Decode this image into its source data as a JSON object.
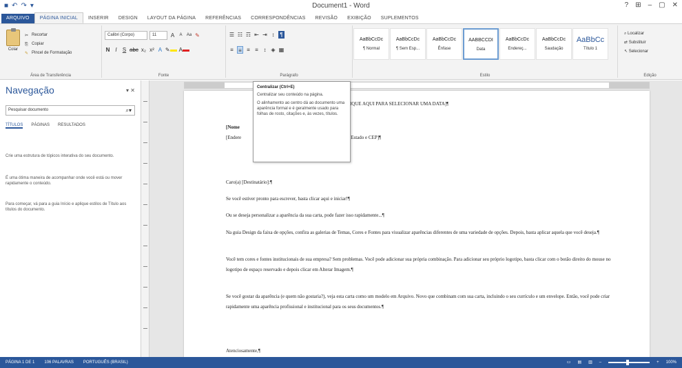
{
  "window": {
    "title": "Document1 - Word",
    "controls": [
      "?",
      "⊞",
      "–",
      "▢",
      "✕"
    ]
  },
  "qat": {
    "save": "■",
    "undo": "↶",
    "redo": "↷",
    "more": "▾"
  },
  "ribbon_tabs": [
    "ARQUIVO",
    "PÁGINA INICIAL",
    "INSERIR",
    "DESIGN",
    "LAYOUT DA PÁGINA",
    "REFERÊNCIAS",
    "CORRESPONDÊNCIAS",
    "REVISÃO",
    "EXIBIÇÃO",
    "SUPLEMENTOS"
  ],
  "clipboard": {
    "paste": "Colar",
    "cut": "Recortar",
    "copy": "Copiar",
    "format_painter": "Pincel de Formatação",
    "label": "Área de Transferência"
  },
  "font": {
    "name": "Calibri (Corpo)",
    "size": "11",
    "label": "Fonte"
  },
  "paragraph": {
    "label": "Parágrafo"
  },
  "styles": {
    "label": "Estilo",
    "items": [
      {
        "preview": "AaBbCcDc",
        "name": "¶ Normal"
      },
      {
        "preview": "AaBbCcDc",
        "name": "¶ Sem Esp..."
      },
      {
        "preview": "AaBbCcDc",
        "name": "Ênfase"
      },
      {
        "preview": "AABBCCDI",
        "name": "Data"
      },
      {
        "preview": "AaBbCcDc",
        "name": "Endereç..."
      },
      {
        "preview": "AaBbCcDc",
        "name": "Saudação"
      },
      {
        "preview": "AaBbCc",
        "name": "Título 1"
      }
    ]
  },
  "editing": {
    "find": "Localizar",
    "replace": "Substituir",
    "select": "Selecionar",
    "label": "Edição"
  },
  "nav_pane": {
    "title": "Navegação",
    "close": "▾ ✕",
    "search_placeholder": "Pesquisar documento",
    "tabs": [
      "TÍTULOS",
      "PÁGINAS",
      "RESULTADOS"
    ],
    "text1": "Crie uma estrutura de tópicos interativa do seu documento.",
    "text2": "É uma ótima maneira de acompanhar onde você está ou mover rapidamente o conteúdo.",
    "text3": "Para começar, vá para a guia Início e aplique estilos de Título aos títulos do documento."
  },
  "tooltip": {
    "title": "Centralizar (Ctrl+E)",
    "line1": "Centralizar seu conteúdo na página.",
    "line2": "O alinhamento ao centro dá ao documento uma aparência formal e é geralmente usado para folhas de rosto, citações e, às vezes, títulos."
  },
  "document": {
    "header_line": "CLIQUE AQUI PARA SELECIONAR UMA DATA]¶",
    "name_line": "[Nome",
    "address_line": "[Endere",
    "address_rest": "ade, Estado e CEP]¶",
    "salutation": "Caro(a) [Destinatário]:¶",
    "p1": "Se você estiver pronto para escrever, basta clicar aqui e iniciar!¶",
    "p2": "Ou se deseja personalizar a aparência da sua carta, pode fazer isso rapidamente...¶",
    "p3": "Na guia Design da faixa de opções, confira as galerias de Temas, Cores e Fontes para visualizar aparências diferentes de uma variedade de opções. Depois, basta aplicar aquela que você deseja.¶",
    "p4": "Você tem cores e fontes institucionais de sua empresa? Sem problemas. Você pode adicionar sua própria combinação. Para adicionar seu próprio logotipo, basta clicar com o botão direito do mouse no logotipo de espaço reservado e depois clicar em Alterar Imagem.¶",
    "p5": "Se você gostar da aparência (e quem não gostaria?), veja esta carta como um modelo em Arquivo. Novo que combinam com sua carta, incluindo o seu currículo e um envelope. Então, você pode criar rapidamente uma aparência profissional e institucional para os seus documentos.¶",
    "closing": "Atenciosamente,¶"
  },
  "statusbar": {
    "page": "PÁGINA 1 DE 1",
    "words": "106 PALAVRAS",
    "lang": "PORTUGUÊS (BRASIL)",
    "zoom": "100%"
  }
}
